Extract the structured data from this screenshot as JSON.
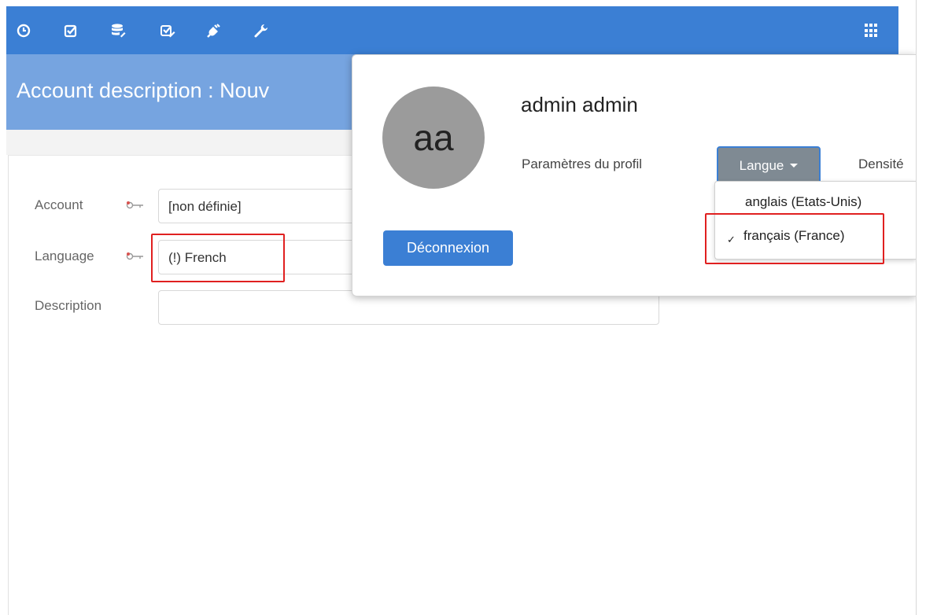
{
  "toolbar": {
    "icons": [
      "clock-icon",
      "checkbox-icon",
      "database-edit-icon",
      "checklist-edit-icon",
      "plug-icon",
      "wrench-icon",
      "apps-grid-icon"
    ],
    "color": "#3b7fd4"
  },
  "title_bar": {
    "title": "Account description  :  Nouv",
    "color": "#76a4e0"
  },
  "form": {
    "account": {
      "label": "Account",
      "value": "[non définie]"
    },
    "language": {
      "label": "Language",
      "value": "(!) French"
    },
    "description": {
      "label": "Description",
      "value": ""
    }
  },
  "profile_popover": {
    "avatar_initials": "aa",
    "user_name": "admin admin",
    "profile_settings_label": "Paramètres du profil",
    "language_button": "Langue",
    "density_label": "Densité",
    "logout_button": "Déconnexion"
  },
  "language_menu": {
    "items": [
      {
        "label": "anglais (Etats-Unis)",
        "selected": false
      },
      {
        "label": "français (France)",
        "selected": true
      }
    ],
    "check_mark": "✓"
  },
  "highlight_color": "#e02020"
}
